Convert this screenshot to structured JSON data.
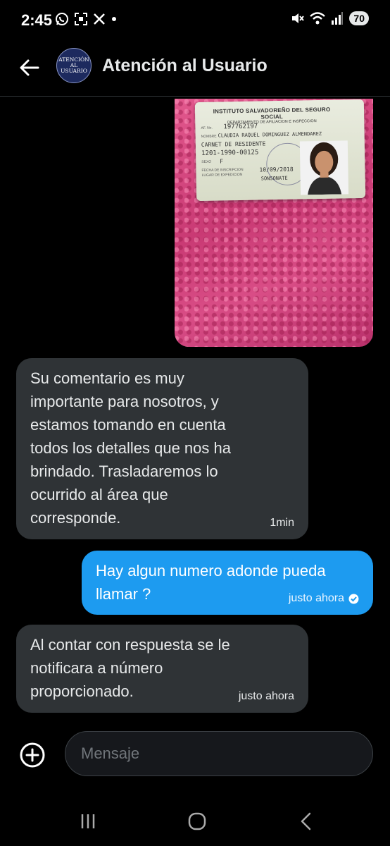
{
  "status_bar": {
    "time": "2:45",
    "battery": "70",
    "left_icons": [
      "whatsapp-icon",
      "scan-icon",
      "x-logo-icon",
      "dot-icon"
    ],
    "right_icons": [
      "mute-icon",
      "wifi-icon",
      "signal-icon"
    ]
  },
  "header": {
    "title": "Atención al Usuario",
    "avatar_text_line1": "ATENCIÓN",
    "avatar_text_line2": "AL USUARIO"
  },
  "image_message": {
    "card_title": "INSTITUTO SALVADOREÑO DEL SEGURO SOCIAL",
    "card_subtitle": "DEPARTAMENTO DE AFILIACION E INSPECCION",
    "af_label": "AF. No.",
    "af_number": "197762197",
    "name_label": "NOMBRE",
    "name": "CLAUDIA RAQUEL DOMINGUEZ ALMENDAREZ",
    "doc_type": "CARNET DE RESIDENTE",
    "doc_number": "1201-1990-00125",
    "sex_label": "SEXO",
    "sex": "F",
    "date_label": "FECHA DE INSCRIPCION",
    "place_label": "LUGAR DE EXPEDICION",
    "date": "10/09/2018",
    "place": "SONSONATE"
  },
  "messages": [
    {
      "direction": "incoming",
      "text": "Su comentario es muy\nimportante para nosotros, y\nestamos tomando en cuenta\ntodos los detalles que nos ha\nbrindado. Trasladaremos  lo\nocurrido al área que\ncorresponde.",
      "time": "1min"
    },
    {
      "direction": "outgoing",
      "text": "Hay algun numero adonde pueda\nllamar ?",
      "time": "justo ahora"
    },
    {
      "direction": "incoming",
      "text": "Al contar con respuesta se le\nnotificara a número\nproporcionado.",
      "time": "justo ahora"
    }
  ],
  "composer": {
    "placeholder": "Mensaje"
  },
  "colors": {
    "background": "#000000",
    "incoming_bubble": "#2f3336",
    "outgoing_bubble": "#1d9bf0",
    "text": "#e7e9ea"
  }
}
